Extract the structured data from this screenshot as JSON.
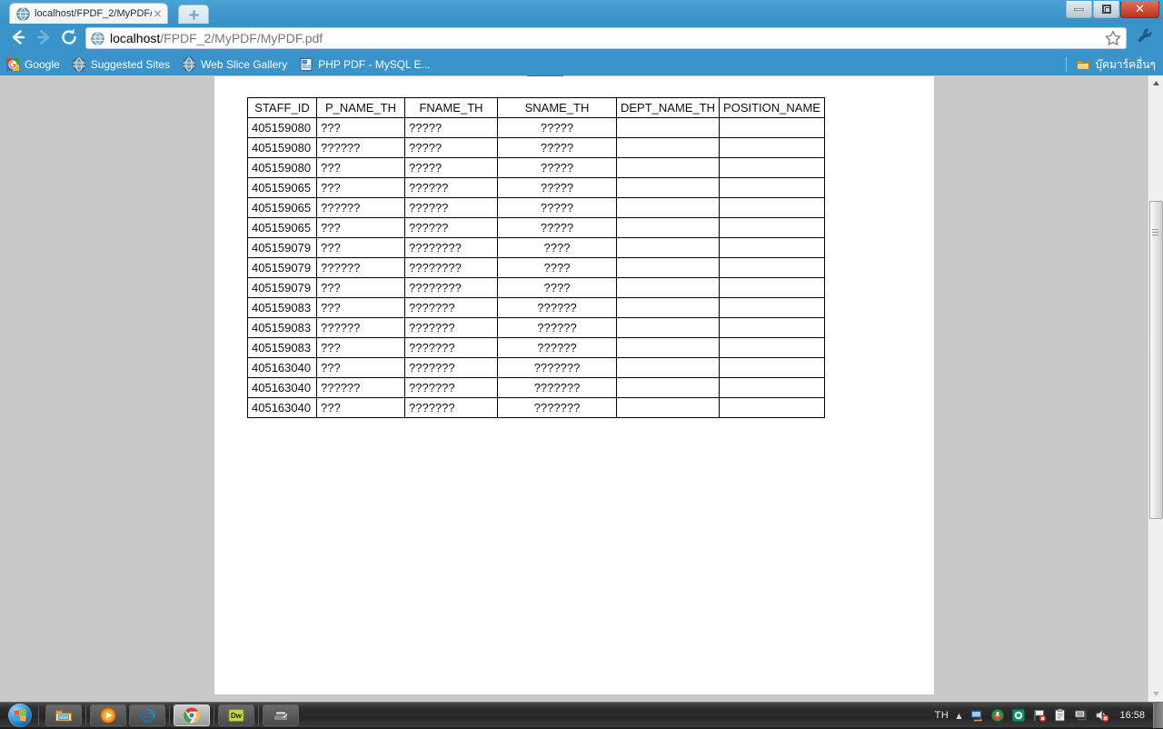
{
  "window": {
    "minimize_label": "Minimize",
    "restore_label": "Restore",
    "close_label": "Close"
  },
  "tab": {
    "title": "localhost/FPDF_2/MyPDF/M",
    "favicon": "globe-icon",
    "close_glyph": "×",
    "newtab_label": "New Tab"
  },
  "toolbar": {
    "back_glyph": "←",
    "forward_glyph": "→",
    "reload_glyph": "⟳",
    "url_host": "localhost",
    "url_path": "/FPDF_2/MyPDF/MyPDF.pdf",
    "url_full": "localhost/FPDF_2/MyPDF/MyPDF.pdf",
    "star_label": "Bookmark this page",
    "wrench_label": "Customize and control Google Chrome"
  },
  "bookmarks": {
    "items": [
      {
        "label": "Google",
        "icon": "google-icon"
      },
      {
        "label": "Suggested Sites",
        "icon": "globe-icon"
      },
      {
        "label": "Web Slice Gallery",
        "icon": "globe-icon"
      },
      {
        "label": "PHP PDF - MySQL E...",
        "icon": "page-icon"
      }
    ],
    "other": {
      "label": "บุ๊คมาร์คอื่นๆ",
      "icon": "folder-icon"
    }
  },
  "pdf": {
    "table": {
      "columns": [
        "STAFF_ID",
        "P_NAME_TH",
        "FNAME_TH",
        "SNAME_TH",
        "DEPT_NAME_TH",
        "POSITION_NAME"
      ],
      "rows": [
        [
          "405159080",
          "???",
          "?????",
          "?????",
          "",
          ""
        ],
        [
          "405159080",
          "??????",
          "?????",
          "?????",
          "",
          ""
        ],
        [
          "405159080",
          "???",
          "?????",
          "?????",
          "",
          ""
        ],
        [
          "405159065",
          "???",
          "??????",
          "?????",
          "",
          ""
        ],
        [
          "405159065",
          "??????",
          "??????",
          "?????",
          "",
          ""
        ],
        [
          "405159065",
          "???",
          "??????",
          "?????",
          "",
          ""
        ],
        [
          "405159079",
          "???",
          "????????",
          "????",
          "",
          ""
        ],
        [
          "405159079",
          "??????",
          "????????",
          "????",
          "",
          ""
        ],
        [
          "405159079",
          "???",
          "????????",
          "????",
          "",
          ""
        ],
        [
          "405159083",
          "???",
          "???????",
          "??????",
          "",
          ""
        ],
        [
          "405159083",
          "??????",
          "???????",
          "??????",
          "",
          ""
        ],
        [
          "405159083",
          "???",
          "???????",
          "??????",
          "",
          ""
        ],
        [
          "405163040",
          "???",
          "???????",
          "???????",
          "",
          ""
        ],
        [
          "405163040",
          "??????",
          "???????",
          "???????",
          "",
          ""
        ],
        [
          "405163040",
          "???",
          "???????",
          "???????",
          "",
          ""
        ]
      ]
    }
  },
  "scrollbar": {
    "up_glyph": "▲",
    "down_glyph": "▼"
  },
  "taskbar": {
    "start_label": "Start",
    "buttons": [
      {
        "name": "windows-explorer",
        "icon": "folder-icon"
      },
      {
        "name": "windows-media-player",
        "icon": "play-icon"
      },
      {
        "name": "internet-explorer",
        "icon": "ie-icon"
      },
      {
        "name": "google-chrome",
        "icon": "chrome-icon",
        "active": true
      },
      {
        "name": "dreamweaver",
        "icon": "dw-icon",
        "label": "Dw"
      },
      {
        "name": "scanner-app",
        "icon": "scanner-icon"
      }
    ],
    "tray": {
      "language": "TH",
      "show_hidden_glyph": "▲",
      "icons": [
        "network-monitor-icon",
        "updater-icon",
        "antivirus-icon",
        "flag-alert-icon",
        "clipboard-icon",
        "network-icon",
        "volume-mute-icon"
      ],
      "clock": "16:58"
    }
  }
}
